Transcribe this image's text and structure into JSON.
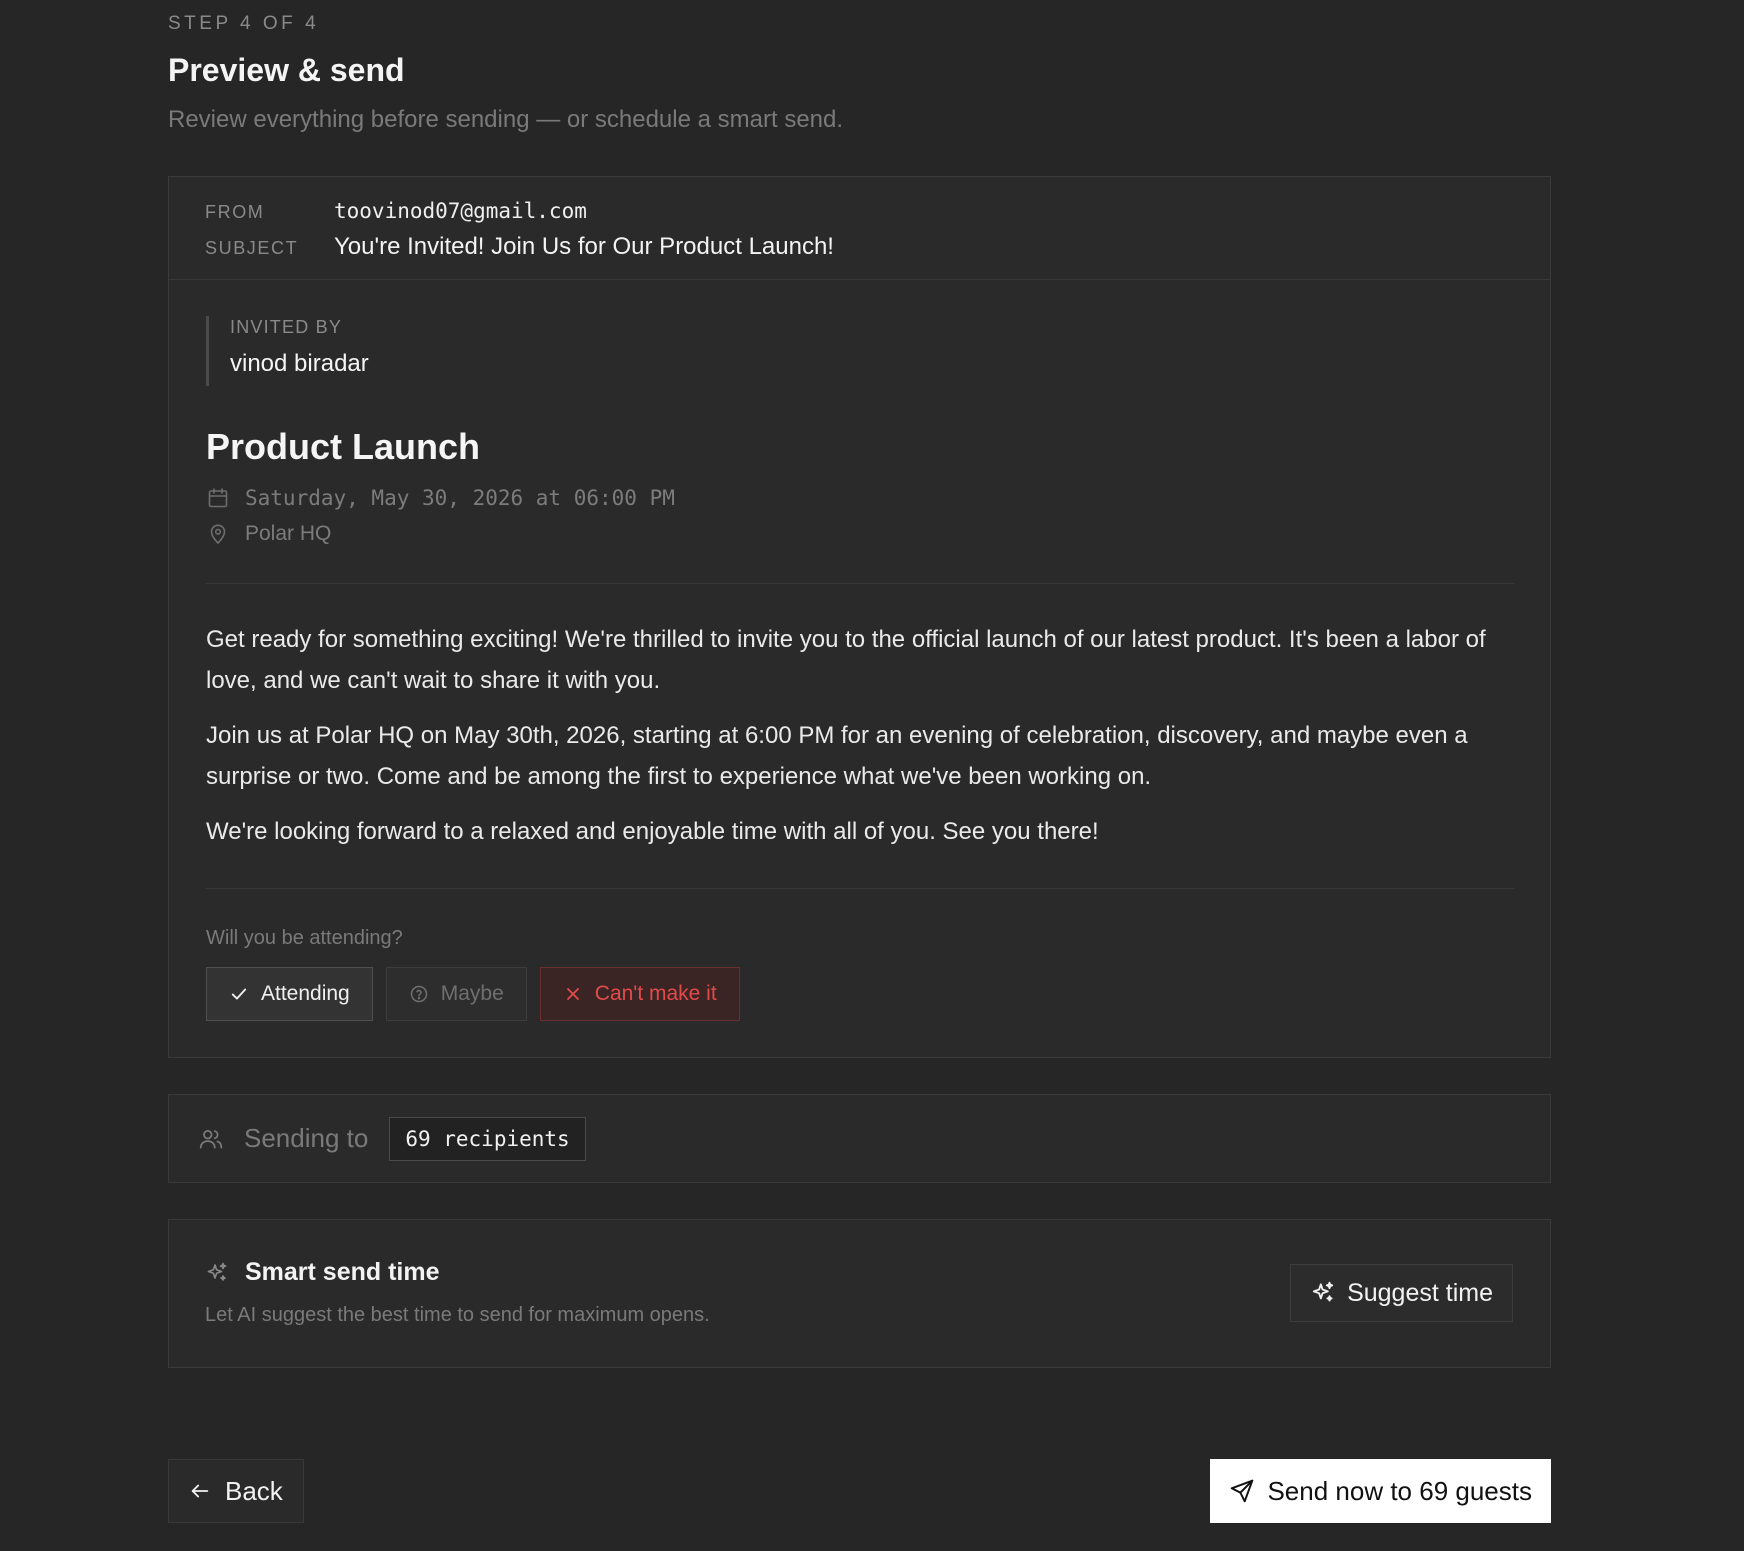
{
  "header": {
    "step": "STEP 4 OF 4",
    "title": "Preview & send",
    "subtitle": "Review everything before sending — or schedule a smart send."
  },
  "email": {
    "from_label": "FROM",
    "from_value": "toovinod07@gmail.com",
    "subject_label": "SUBJECT",
    "subject_value": "You're Invited! Join Us for Our Product Launch!"
  },
  "invite": {
    "invited_by_label": "INVITED BY",
    "invited_by_name": "vinod biradar",
    "event_title": "Product Launch",
    "date_time": "Saturday, May 30, 2026 at 06:00 PM",
    "location": "Polar HQ",
    "message": [
      "Get ready for something exciting! We're thrilled to invite you to the official launch of our latest product. It's been a labor of love, and we can't wait to share it with you.",
      "Join us at Polar HQ on May 30th, 2026, starting at 6:00 PM for an evening of celebration, discovery, and maybe even a surprise or two. Come and be among the first to experience what we've been working on.",
      "We're looking forward to a relaxed and enjoyable time with all of you. See you there!"
    ],
    "rsvp": {
      "question": "Will you be attending?",
      "attending": "Attending",
      "maybe": "Maybe",
      "cant": "Can't make it"
    }
  },
  "sending": {
    "label": "Sending to",
    "recipients": "69 recipients"
  },
  "smart_send": {
    "title": "Smart send time",
    "description": "Let AI suggest the best time to send for maximum opens.",
    "button": "Suggest time"
  },
  "footer": {
    "back": "Back",
    "send": "Send now to 69 guests"
  },
  "colors": {
    "background": "#262626",
    "card": "#2a2a2a",
    "danger": "#e34a4a",
    "primary_button": "#ffffff"
  },
  "icons": {
    "date": "calendar-icon",
    "location": "map-pin-icon",
    "attending": "check-icon",
    "maybe": "help-circle-icon",
    "cant": "x-icon",
    "recipients": "users-icon",
    "smart": "sparkles-icon",
    "back": "arrow-left-icon",
    "send": "send-icon"
  }
}
